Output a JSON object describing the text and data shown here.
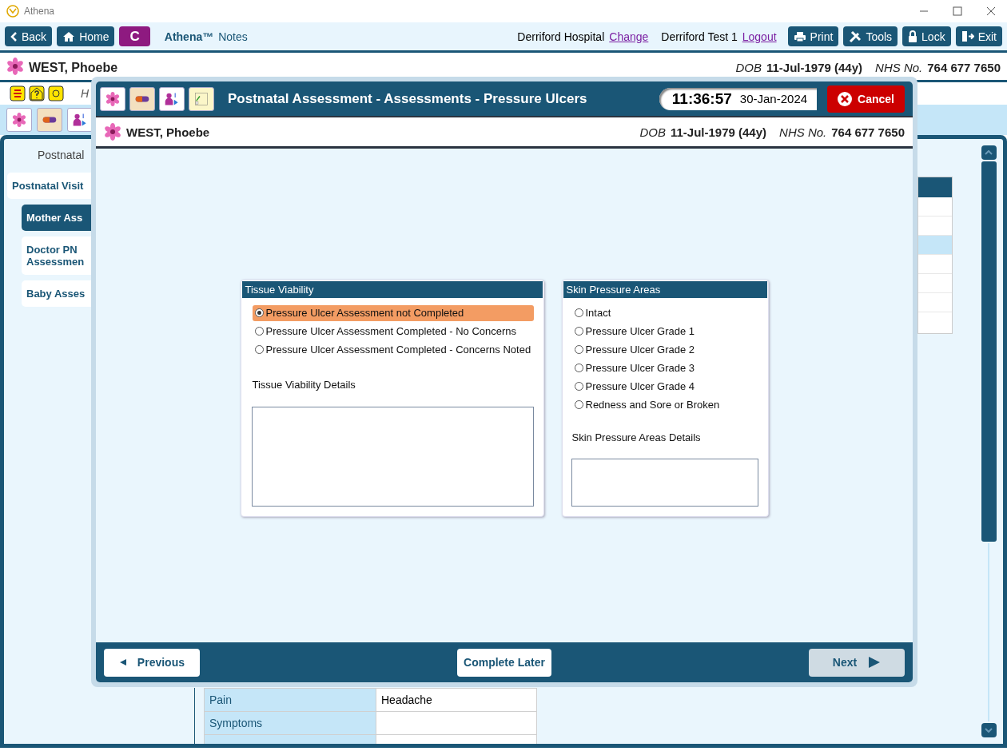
{
  "window": {
    "title": "Athena"
  },
  "toolbar": {
    "left_buttons": [
      {
        "kind": "back",
        "label": "Back"
      },
      {
        "kind": "home",
        "label": "Home"
      },
      {
        "kind": "letter",
        "label": "C"
      }
    ],
    "app_name": "Athena™",
    "app_section": "Notes",
    "location": "Derriford Hospital",
    "location_link": "Change",
    "user": "Derriford Test 1",
    "user_link": "Logout",
    "right_buttons": [
      {
        "kind": "print",
        "label": "Print"
      },
      {
        "kind": "tools",
        "label": "Tools"
      },
      {
        "kind": "lock",
        "label": "Lock"
      },
      {
        "kind": "exit",
        "label": "Exit"
      }
    ]
  },
  "patient": {
    "name": "WEST, Phoebe",
    "dob_label": "DOB",
    "dob": "11-Jul-1979 (44y)",
    "nhs_label": "NHS No.",
    "nhs": "764 677 7650"
  },
  "header_text": "H",
  "sidebar": {
    "heading": "Postnatal",
    "items": [
      {
        "label": "Postnatal Visit",
        "selected": false,
        "children": [
          {
            "label": "Mother Ass",
            "selected": true
          },
          {
            "label": "Doctor PN Assessmen",
            "selected": false
          },
          {
            "label": "Baby Asses",
            "selected": false
          }
        ]
      }
    ]
  },
  "side_table": {
    "rows": [
      {
        "selected": false
      },
      {
        "selected": false
      },
      {
        "selected": true
      },
      {
        "selected": false
      },
      {
        "selected": false
      },
      {
        "selected": false
      }
    ]
  },
  "details_table": {
    "rows": [
      {
        "label": "Pain",
        "value": "Headache"
      },
      {
        "label": "Symptoms"
      }
    ]
  },
  "modal": {
    "title": "Postnatal Assessment - Assessments - Pressure Ulcers",
    "time": "11:36:57",
    "date": "30-Jan-2024",
    "cancel": "Cancel",
    "patient": {
      "name": "WEST, Phoebe",
      "dob_label": "DOB",
      "dob": "11-Jul-1979 (44y)",
      "nhs_label": "NHS No.",
      "nhs": "764 677 7650"
    },
    "panels": [
      {
        "title": "Tissue Viability",
        "options": [
          {
            "label": "Pressure Ulcer Assessment not Completed",
            "selected": true
          },
          {
            "label": "Pressure Ulcer Assessment Completed - No Concerns",
            "selected": false
          },
          {
            "label": "Pressure Ulcer Assessment Completed - Concerns Noted",
            "selected": false
          }
        ],
        "details_label": "Tissue Viability Details"
      },
      {
        "title": "Skin Pressure Areas",
        "options": [
          {
            "label": "Intact",
            "selected": false
          },
          {
            "label": "Pressure Ulcer Grade 1",
            "selected": false
          },
          {
            "label": "Pressure Ulcer Grade 2",
            "selected": false
          },
          {
            "label": "Pressure Ulcer Grade 3",
            "selected": false
          },
          {
            "label": "Pressure Ulcer Grade 4",
            "selected": false
          },
          {
            "label": "Redness and Sore or Broken",
            "selected": false
          }
        ],
        "details_label": "Skin Pressure Areas Details"
      }
    ],
    "footer": {
      "previous": {
        "label": "Previous",
        "disabled": false
      },
      "complete_later": "Complete Later",
      "next": {
        "label": "Next",
        "disabled": true
      }
    }
  }
}
